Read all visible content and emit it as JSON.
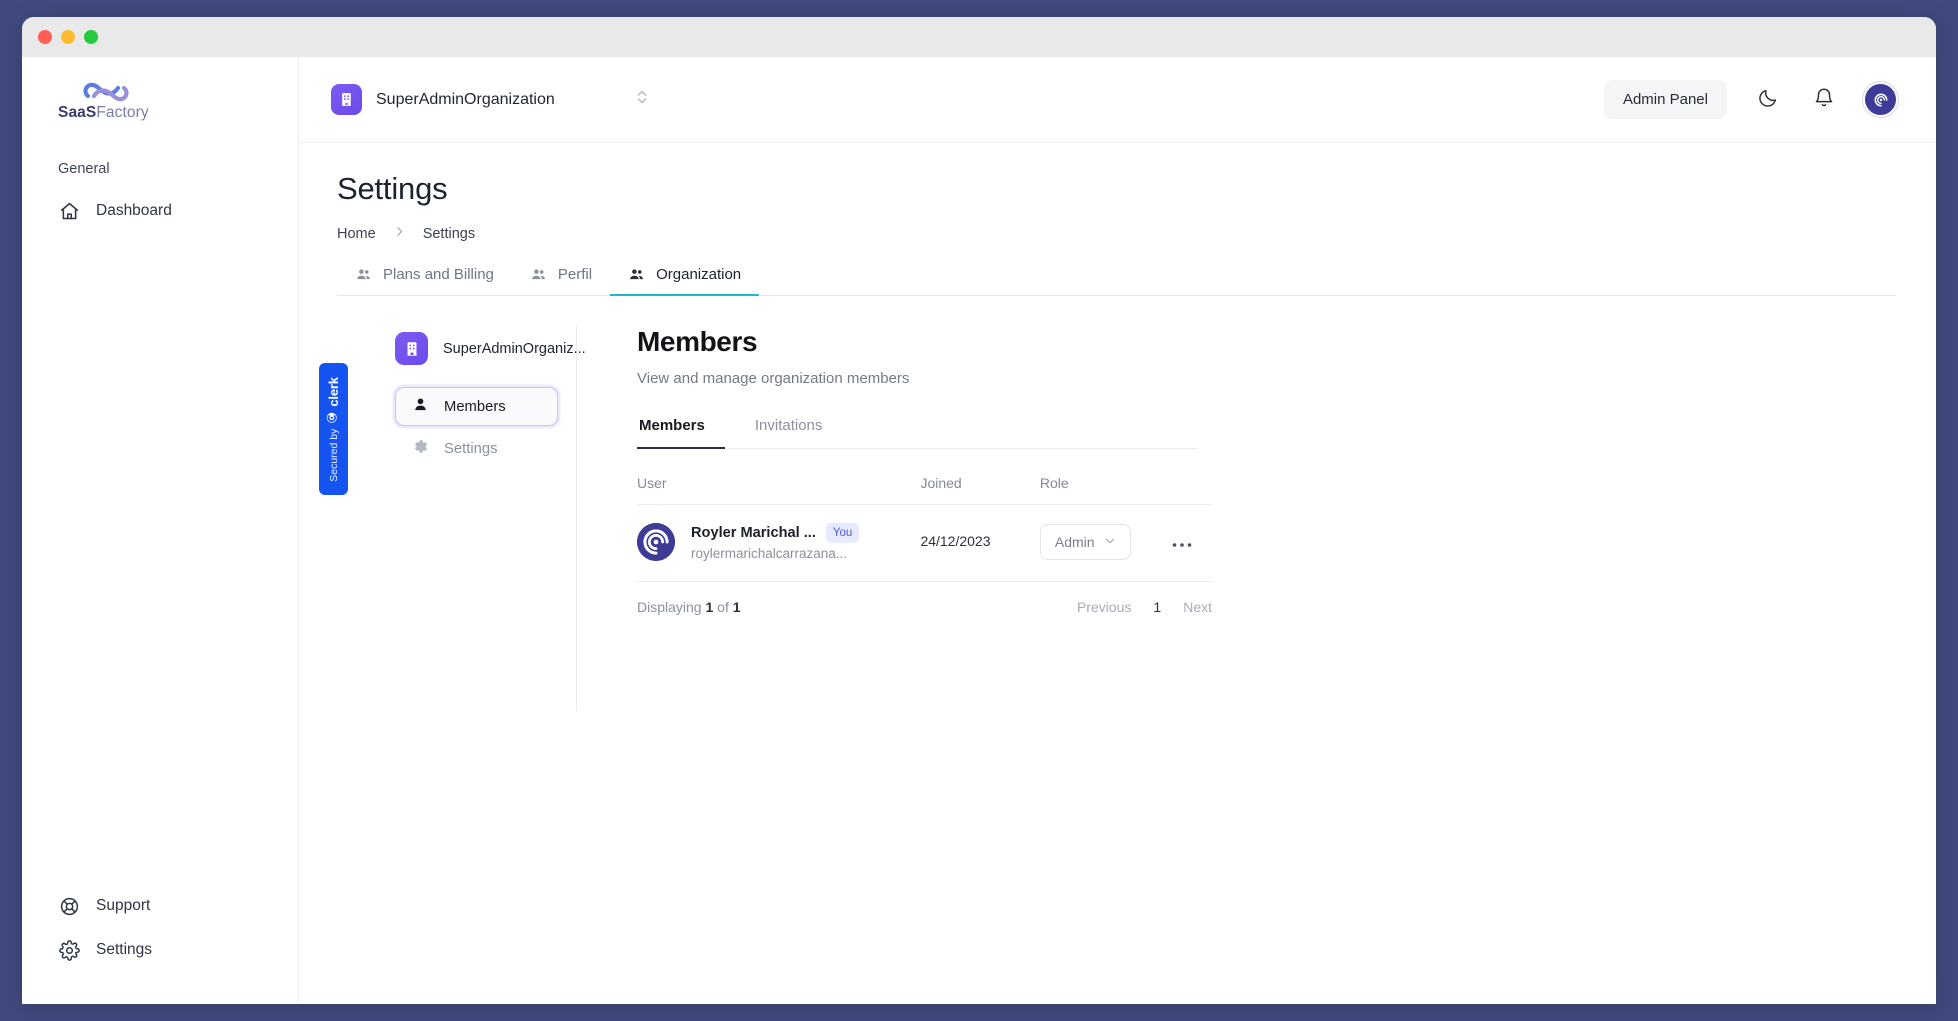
{
  "window": {
    "traffic_lights": [
      "close",
      "minimize",
      "maximize"
    ]
  },
  "sidebar": {
    "logo": {
      "bold": "SaaS",
      "light": "Factory",
      "icon": "infinity-cloud-logo"
    },
    "section_label": "General",
    "items": [
      {
        "label": "Dashboard",
        "icon": "home-icon"
      }
    ],
    "bottom_items": [
      {
        "label": "Support",
        "icon": "lifebuoy-icon"
      },
      {
        "label": "Settings",
        "icon": "gear-icon"
      }
    ]
  },
  "topbar": {
    "org_name": "SuperAdminOrganization",
    "org_icon": "building-icon",
    "switcher_icon": "chevron-up-down-icon",
    "admin_panel_label": "Admin Panel",
    "theme_toggle_icon": "moon-icon",
    "notifications_icon": "bell-icon",
    "avatar_icon": "user-avatar"
  },
  "page": {
    "title": "Settings",
    "breadcrumb": [
      {
        "label": "Home"
      },
      {
        "label": "Settings"
      }
    ],
    "breadcrumb_separator": "›"
  },
  "tabs": [
    {
      "label": "Plans and Billing",
      "icon": "users-icon",
      "active": false
    },
    {
      "label": "Perfil",
      "icon": "users-icon",
      "active": false
    },
    {
      "label": "Organization",
      "icon": "users-icon",
      "active": true
    }
  ],
  "clerk": {
    "badge": {
      "secured_by": "Secured by",
      "brand": "clerk",
      "logo_icon": "clerk-logo-icon",
      "color": "#1554f0"
    },
    "org_name": "SuperAdminOrganiz...",
    "org_icon": "building-icon",
    "nav": [
      {
        "label": "Members",
        "icon": "person-icon",
        "active": true
      },
      {
        "label": "Settings",
        "icon": "gear-icon",
        "active": false
      }
    ]
  },
  "members": {
    "title": "Members",
    "subtitle": "View and manage organization members",
    "tabs": [
      {
        "label": "Members",
        "active": true
      },
      {
        "label": "Invitations",
        "active": false
      }
    ],
    "columns": [
      "User",
      "Joined",
      "Role"
    ],
    "rows": [
      {
        "name": "Royler Marichal ...",
        "badge": "You",
        "email": "roylermarichalcarrazana...",
        "joined": "24/12/2023",
        "role": "Admin",
        "menu_icon": "ellipsis-icon",
        "avatar_icon": "spiral-avatar"
      }
    ],
    "footer": {
      "displaying_prefix": "Displaying",
      "displaying_count": "1",
      "displaying_middle": "of",
      "displaying_total": "1",
      "previous_label": "Previous",
      "page_number": "1",
      "next_label": "Next"
    }
  },
  "colors": {
    "desktop_bg": "#414a7e",
    "accent_purple": "#6d49ee",
    "tab_active_underline": "#1fb6d4",
    "clerk_blue": "#1554f0",
    "avatar_indigo": "#3f3c98",
    "you_badge_bg": "#e6eafe",
    "you_badge_text": "#4a5bd6"
  }
}
